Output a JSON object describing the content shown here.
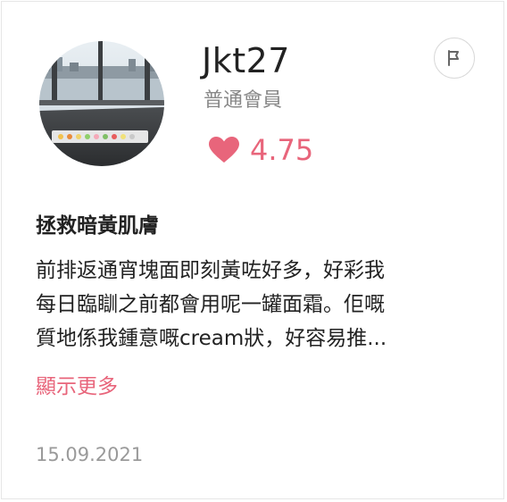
{
  "user": {
    "name": "Jkt27",
    "member_level": "普通會員",
    "rating": "4.75",
    "avatar_icon": "user-avatar-photo"
  },
  "actions": {
    "report_icon": "flag-icon"
  },
  "review": {
    "title": "拯救暗黃肌膚",
    "body_lines": [
      "前排返通宵塊面即刻黃咗好多，好彩我",
      "每日臨瞓之前都會用呢一罐面霜。佢嘅",
      "質地係我鍾意嘅cream狀，好容易推..."
    ],
    "show_more_label": "顯示更多",
    "date": "15.09.2021"
  },
  "colors": {
    "accent": "#e8657b",
    "muted": "#888888",
    "text": "#222222"
  }
}
